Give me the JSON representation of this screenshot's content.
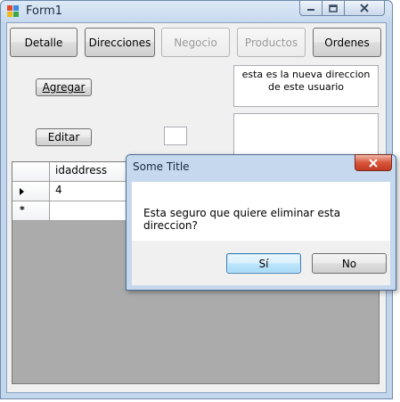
{
  "window": {
    "title": "Form1"
  },
  "toolbar": {
    "detalle": "Detalle",
    "direcciones": "Direcciones",
    "negocio": "Negocio",
    "productos": "Productos",
    "ordenes": "Ordenes"
  },
  "actions": {
    "agregar": "Agregar",
    "editar": "Editar"
  },
  "notes": {
    "address_text": "esta es la nueva direccion de este usuario",
    "second_text": ""
  },
  "small_input": {
    "value": ""
  },
  "grid": {
    "columns": [
      "idaddress"
    ],
    "rows": [
      {
        "indicator": "current",
        "idaddress": "4"
      },
      {
        "indicator": "new",
        "idaddress": ""
      }
    ]
  },
  "dialog": {
    "title": "Some Title",
    "message": "Esta seguro que quiere eliminar esta direccion?",
    "yes_label": "Sí",
    "no_label": "No"
  },
  "colors": {
    "title_bar": "#c7d9ee",
    "client_bg": "#f0f0f0",
    "grid_bg": "#ababab",
    "close_red": "#c23a21",
    "focus_blue": "#3c7fb1"
  }
}
